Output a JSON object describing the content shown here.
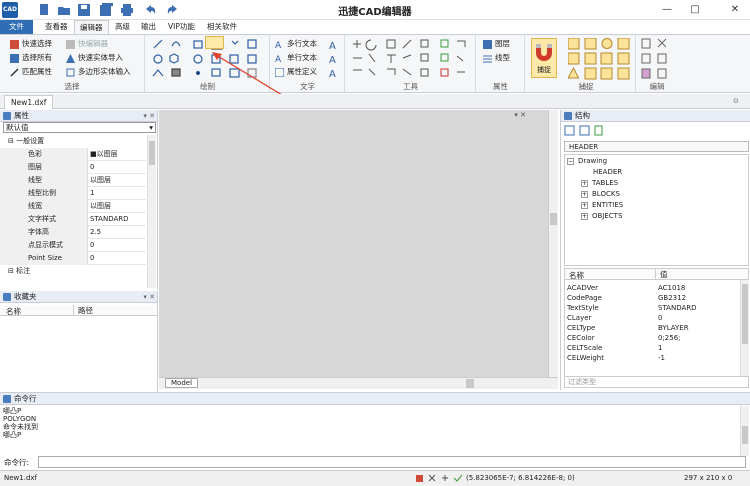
{
  "titlebar": {
    "logo": "CAD",
    "title": "迅捷CAD编辑器",
    "quick_icons": [
      "new-file-icon",
      "open-folder-icon",
      "save-icon",
      "save-all-icon",
      "print-icon",
      "undo-icon",
      "redo-icon"
    ],
    "minimize": "—",
    "maximize": "□",
    "close": "✕"
  },
  "tabs": [
    {
      "label": "文件"
    },
    {
      "label": "查看器"
    },
    {
      "label": "编辑器"
    },
    {
      "label": "高级"
    },
    {
      "label": "输出"
    },
    {
      "label": "VIP功能"
    },
    {
      "label": "相关软件"
    }
  ],
  "ribbon": {
    "select": {
      "label": "选择",
      "quick_select": "快速选择",
      "select_all": "选择所有",
      "match_props": "匹配属性",
      "quick_editor": "快编辑器",
      "quick_entity_import": "快速实体导入",
      "polygon_entity_input": "多边形实体输入"
    },
    "draw": {
      "label": "绘制"
    },
    "text": {
      "label": "文字",
      "mtext": "多行文本",
      "stext": "单行文本",
      "attdef": "属性定义"
    },
    "tools": {
      "label": "工具"
    },
    "props": {
      "label": "属性",
      "layer": "图层",
      "linetype": "线型"
    },
    "snap": {
      "label": "捕捉",
      "button": "捕捉"
    },
    "edit": {
      "label": "编辑"
    }
  },
  "doc_tab": "New1.dxf",
  "properties": {
    "title": "属性",
    "selector": "默认值",
    "group_general": "一般设置",
    "rows": [
      {
        "key": "色彩",
        "value": "■以图层"
      },
      {
        "key": "图层",
        "value": "0"
      },
      {
        "key": "线型",
        "value": "以图层"
      },
      {
        "key": "线型比例",
        "value": "1"
      },
      {
        "key": "线宽",
        "value": "以图层"
      },
      {
        "key": "文字样式",
        "value": "STANDARD"
      },
      {
        "key": "字体高",
        "value": "2.5"
      },
      {
        "key": "点显示模式",
        "value": "0"
      },
      {
        "key": "Point Size",
        "value": "0"
      }
    ],
    "group_annotation": "标注"
  },
  "favorites": {
    "title": "收藏夹",
    "col_name": "名称",
    "col_path": "路径"
  },
  "canvas": {
    "model_tab": "Model"
  },
  "structure": {
    "title": "结构",
    "header_label": "HEADER",
    "root": "Drawing",
    "nodes": [
      "HEADER",
      "TABLES",
      "BLOCKS",
      "ENTITIES",
      "OBJECTS"
    ],
    "col_name": "名称",
    "col_value": "值",
    "vars": [
      {
        "k": "ACADVer",
        "v": "AC1018"
      },
      {
        "k": "CodePage",
        "v": "GB2312"
      },
      {
        "k": "TextStyle",
        "v": "STANDARD"
      },
      {
        "k": "CLayer",
        "v": "0"
      },
      {
        "k": "CELType",
        "v": "BYLAYER"
      },
      {
        "k": "CEColor",
        "v": "0;256;"
      },
      {
        "k": "CELTScale",
        "v": "1"
      },
      {
        "k": "CELWeight",
        "v": "-1"
      }
    ],
    "filter_placeholder": "过滤类型"
  },
  "command": {
    "title": "命令行",
    "lines": [
      "哪凸P",
      "POLYGON",
      "命令未找到",
      "哪凸P"
    ],
    "input_label": "命令行:"
  },
  "status": {
    "file": "New1.dxf",
    "coords": "(5.823065E-7; 6.814226E-8; 0)",
    "size": "297 x 210 x 0"
  },
  "colors": {
    "accent": "#2f6eb5",
    "canvas": "#d7d7d7",
    "annotation_arrow": "#e0442e"
  }
}
